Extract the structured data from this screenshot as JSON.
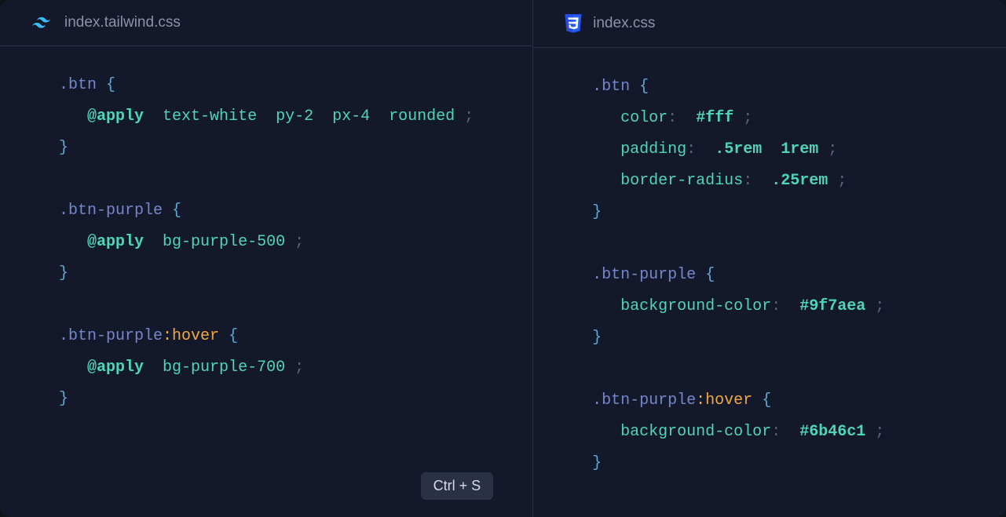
{
  "left": {
    "filename": "index.tailwind.css",
    "icon": "tailwind",
    "shortcut": "Ctrl + S",
    "code": {
      "rule1": {
        "selector": ".btn",
        "directive": "@apply",
        "utils": "text-white  py-2  px-4  rounded"
      },
      "rule2": {
        "selector": ".btn-purple",
        "directive": "@apply",
        "utils": "bg-purple-500"
      },
      "rule3": {
        "selector": ".btn-purple",
        "pseudo": ":hover",
        "directive": "@apply",
        "utils": "bg-purple-700"
      }
    }
  },
  "right": {
    "filename": "index.css",
    "icon": "css3",
    "code": {
      "rule1": {
        "selector": ".btn",
        "decls": [
          {
            "prop": "color",
            "value": "#fff"
          },
          {
            "prop": "padding",
            "value": ".5rem  1rem"
          },
          {
            "prop": "border-radius",
            "value": ".25rem"
          }
        ]
      },
      "rule2": {
        "selector": ".btn-purple",
        "decls": [
          {
            "prop": "background-color",
            "value": "#9f7aea"
          }
        ]
      },
      "rule3": {
        "selector": ".btn-purple",
        "pseudo": ":hover",
        "decls": [
          {
            "prop": "background-color",
            "value": "#6b46c1"
          }
        ]
      }
    }
  },
  "colors": {
    "selector": "#7587c9",
    "pseudo": "#f0a842",
    "apply": "#4fd5ba",
    "util": "#4fd5ba",
    "brace": "#5fa8d3",
    "punct": "#5b6178"
  }
}
